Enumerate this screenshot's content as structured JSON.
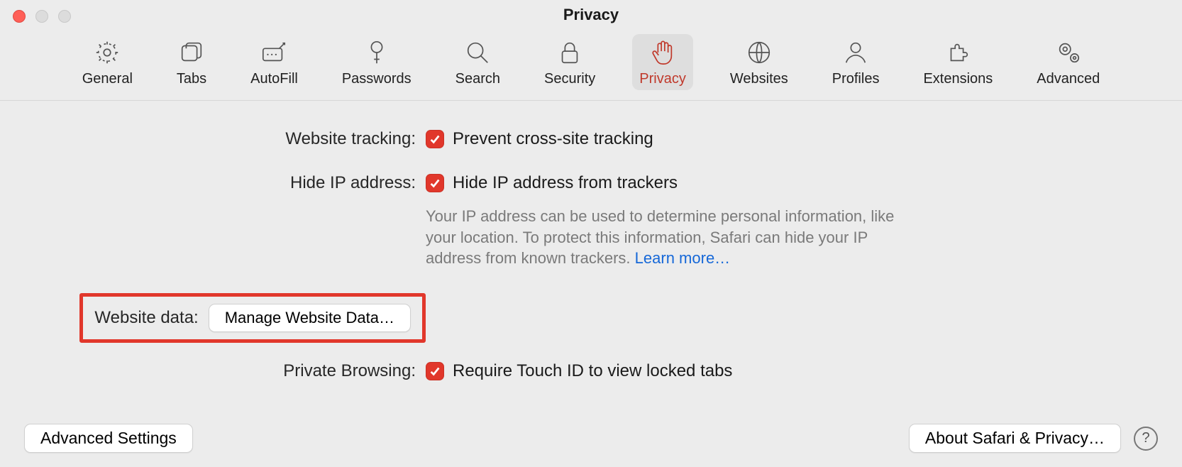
{
  "window_title": "Privacy",
  "tabs": [
    {
      "label": "General"
    },
    {
      "label": "Tabs"
    },
    {
      "label": "AutoFill"
    },
    {
      "label": "Passwords"
    },
    {
      "label": "Search"
    },
    {
      "label": "Security"
    },
    {
      "label": "Privacy"
    },
    {
      "label": "Websites"
    },
    {
      "label": "Profiles"
    },
    {
      "label": "Extensions"
    },
    {
      "label": "Advanced"
    }
  ],
  "active_tab": "Privacy",
  "rows": {
    "tracking": {
      "label": "Website tracking:",
      "checkbox_label": "Prevent cross-site tracking"
    },
    "hide_ip": {
      "label": "Hide IP address:",
      "checkbox_label": "Hide IP address from trackers",
      "description": "Your IP address can be used to determine personal information, like your location. To protect this information, Safari can hide your IP address from known trackers. ",
      "learn_more": "Learn more…"
    },
    "website_data": {
      "label": "Website data:",
      "button": "Manage Website Data…"
    },
    "private_browsing": {
      "label": "Private Browsing:",
      "checkbox_label": "Require Touch ID to view locked tabs"
    }
  },
  "bottom": {
    "advanced_settings": "Advanced Settings",
    "about": "About Safari & Privacy…",
    "help": "?"
  }
}
